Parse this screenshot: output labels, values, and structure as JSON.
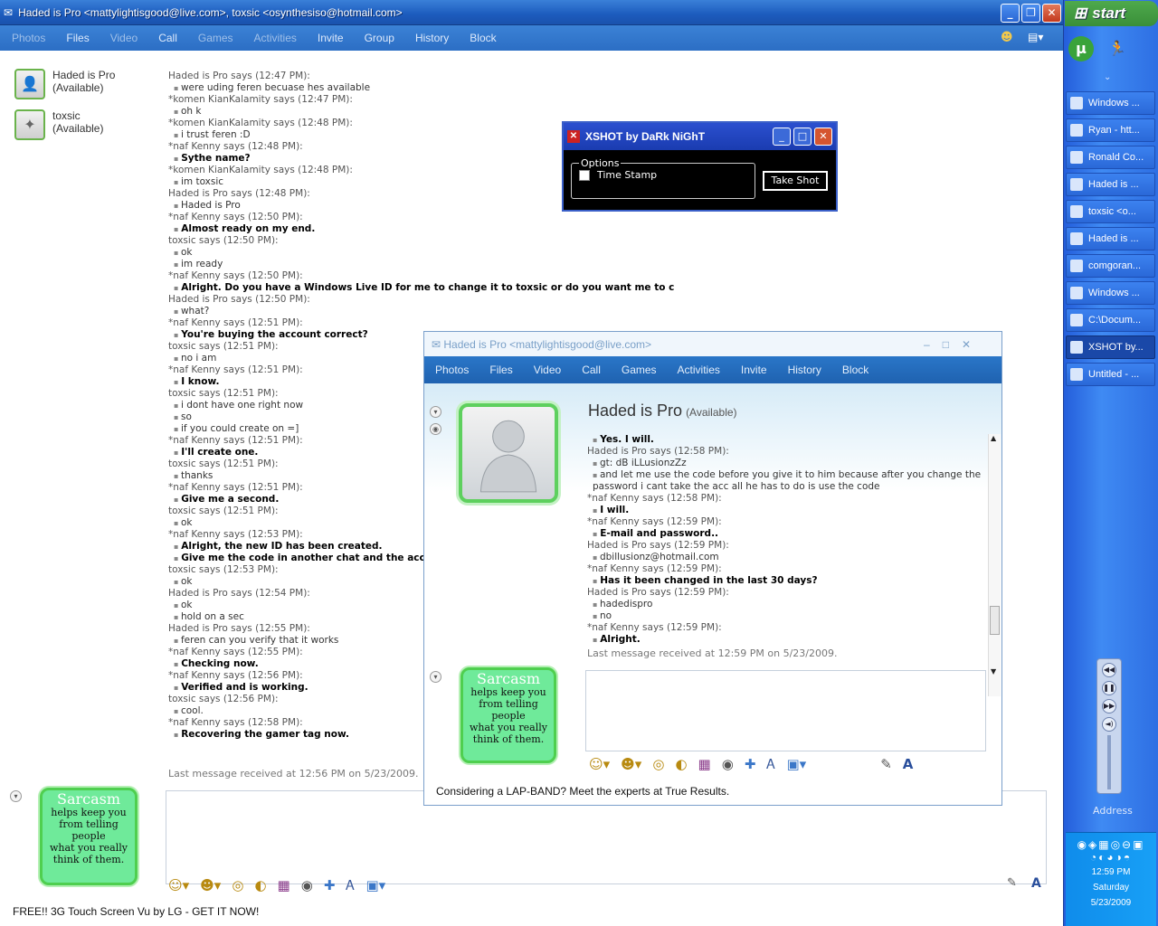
{
  "window": {
    "title": "Haded is Pro <mattylightisgood@live.com>, toxsic <osynthesiso@hotmail.com>",
    "menu": [
      "Photos",
      "Files",
      "Video",
      "Call",
      "Games",
      "Activities",
      "Invite",
      "Group",
      "History",
      "Block"
    ],
    "contacts": [
      {
        "name": "Haded is Pro",
        "status": "(Available)"
      },
      {
        "name": "toxsic",
        "status": "(Available)"
      }
    ],
    "conversation": [
      {
        "who": "Haded is Pro says (12:47 PM):",
        "lines": [
          "were uding feren becuase hes available"
        ],
        "bold": false
      },
      {
        "who": "*komen KianKalamity says (12:47 PM):",
        "lines": [
          "oh k"
        ],
        "bold": false
      },
      {
        "who": "*komen KianKalamity says (12:48 PM):",
        "lines": [
          "i trust feren :D"
        ],
        "bold": false
      },
      {
        "who": "*naf Kenny says (12:48 PM):",
        "lines": [
          "Sythe name?"
        ],
        "bold": true
      },
      {
        "who": "*komen KianKalamity says (12:48 PM):",
        "lines": [
          "im toxsic"
        ],
        "bold": false
      },
      {
        "who": "Haded is Pro says (12:48 PM):",
        "lines": [
          "Haded is Pro"
        ],
        "bold": false
      },
      {
        "who": "*naf Kenny says (12:50 PM):",
        "lines": [
          "Almost ready on my end."
        ],
        "bold": true
      },
      {
        "who": "toxsic says (12:50 PM):",
        "lines": [
          "ok",
          "im ready"
        ],
        "bold": false
      },
      {
        "who": "*naf Kenny says (12:50 PM):",
        "lines": [
          "Alright. Do you have a Windows Live ID for me to change it to toxsic or do you want me to create one?"
        ],
        "bold": true
      },
      {
        "who": "Haded is Pro says (12:50 PM):",
        "lines": [
          "what?"
        ],
        "bold": false
      },
      {
        "who": "*naf Kenny says (12:51 PM):",
        "lines": [
          "You're buying the account correct?"
        ],
        "bold": true
      },
      {
        "who": "toxsic says (12:51 PM):",
        "lines": [
          "no i am"
        ],
        "bold": false
      },
      {
        "who": "*naf Kenny says (12:51 PM):",
        "lines": [
          "I know."
        ],
        "bold": true
      },
      {
        "who": "toxsic says (12:51 PM):",
        "lines": [
          "i dont have one right now",
          "so",
          "if you could create on =]"
        ],
        "bold": false
      },
      {
        "who": "*naf Kenny says (12:51 PM):",
        "lines": [
          "I'll create one."
        ],
        "bold": true
      },
      {
        "who": "toxsic says (12:51 PM):",
        "lines": [
          "thanks"
        ],
        "bold": false
      },
      {
        "who": "*naf Kenny says (12:51 PM):",
        "lines": [
          "Give me a second."
        ],
        "bold": true
      },
      {
        "who": "toxsic says (12:51 PM):",
        "lines": [
          "ok"
        ],
        "bold": false
      },
      {
        "who": "*naf Kenny says (12:53 PM):",
        "lines": [
          "Alright, the new ID has been created.",
          "Give me the code in another chat and the acco"
        ],
        "bold": true
      },
      {
        "who": "toxsic says (12:53 PM):",
        "lines": [
          "ok"
        ],
        "bold": false
      },
      {
        "who": "Haded is Pro says (12:54 PM):",
        "lines": [
          "ok",
          "hold on a sec"
        ],
        "bold": false
      },
      {
        "who": "Haded is Pro says (12:55 PM):",
        "lines": [
          "feren can you verify that it works"
        ],
        "bold": false
      },
      {
        "who": "*naf Kenny says (12:55 PM):",
        "lines": [
          "Checking now."
        ],
        "bold": true
      },
      {
        "who": "*naf Kenny says (12:56 PM):",
        "lines": [
          "Verified and is working."
        ],
        "bold": true
      },
      {
        "who": "toxsic says (12:56 PM):",
        "lines": [
          "cool."
        ],
        "bold": false
      },
      {
        "who": "*naf Kenny says (12:58 PM):",
        "lines": [
          "Recovering the gamer tag now."
        ],
        "bold": true
      }
    ],
    "last_message": "Last message received at 12:56 PM on 5/23/2009.",
    "ad": "FREE!! 3G Touch Screen Vu by LG - GET IT NOW!",
    "sarcasm": {
      "head": "Sarcasm",
      "l1": "helps keep you",
      "l2": "from telling people",
      "l3": "what you really",
      "l4": "think of them."
    }
  },
  "xshot": {
    "title": "XSHOT by DaRk NiGhT",
    "group": "Options",
    "checkbox": "Time Stamp",
    "button": "Take Shot"
  },
  "msn2": {
    "title": "Haded is Pro <mattylightisgood@live.com>",
    "menu": [
      "Photos",
      "Files",
      "Video",
      "Call",
      "Games",
      "Activities",
      "Invite",
      "History",
      "Block"
    ],
    "name": "Haded is Pro",
    "status": "(Available)",
    "conversation": [
      {
        "who": "",
        "lines": [
          "Yes. I will."
        ],
        "bold": true
      },
      {
        "who": "Haded is Pro says (12:58 PM):",
        "lines": [
          "gt: dB iLLusionzZz",
          "and let me use the code before you give it to him because after you change the password i cant take the acc all he has to do is use the code"
        ],
        "bold": false
      },
      {
        "who": "*naf Kenny says (12:58 PM):",
        "lines": [
          "I will."
        ],
        "bold": true
      },
      {
        "who": "*naf Kenny says (12:59 PM):",
        "lines": [
          "E-mail and password.."
        ],
        "bold": true
      },
      {
        "who": "Haded is Pro says (12:59 PM):",
        "lines": [
          "dbillusionz@hotmail.com"
        ],
        "bold": false
      },
      {
        "who": "*naf Kenny says (12:59 PM):",
        "lines": [
          "Has it been changed in the last 30 days?"
        ],
        "bold": true
      },
      {
        "who": "Haded is Pro says (12:59 PM):",
        "lines": [
          "hadedispro",
          "no"
        ],
        "bold": false
      },
      {
        "who": "*naf Kenny says (12:59 PM):",
        "lines": [
          "Alright."
        ],
        "bold": true
      }
    ],
    "last_message": "Last message received at 12:59 PM on 5/23/2009.",
    "ad": "Considering a LAP-BAND? Meet the experts at True Results."
  },
  "taskbar": {
    "start": "start",
    "tasks": [
      "Windows ...",
      "Ryan - htt...",
      "Ronald Co...",
      "Haded is ...",
      "toxsic <o...",
      "Haded is ...",
      "comgoran...",
      "Windows ...",
      "C:\\Docum...",
      "XSHOT by...",
      "Untitled - ..."
    ],
    "address": "Address",
    "time": "12:59 PM",
    "day": "Saturday",
    "date": "5/23/2009"
  }
}
